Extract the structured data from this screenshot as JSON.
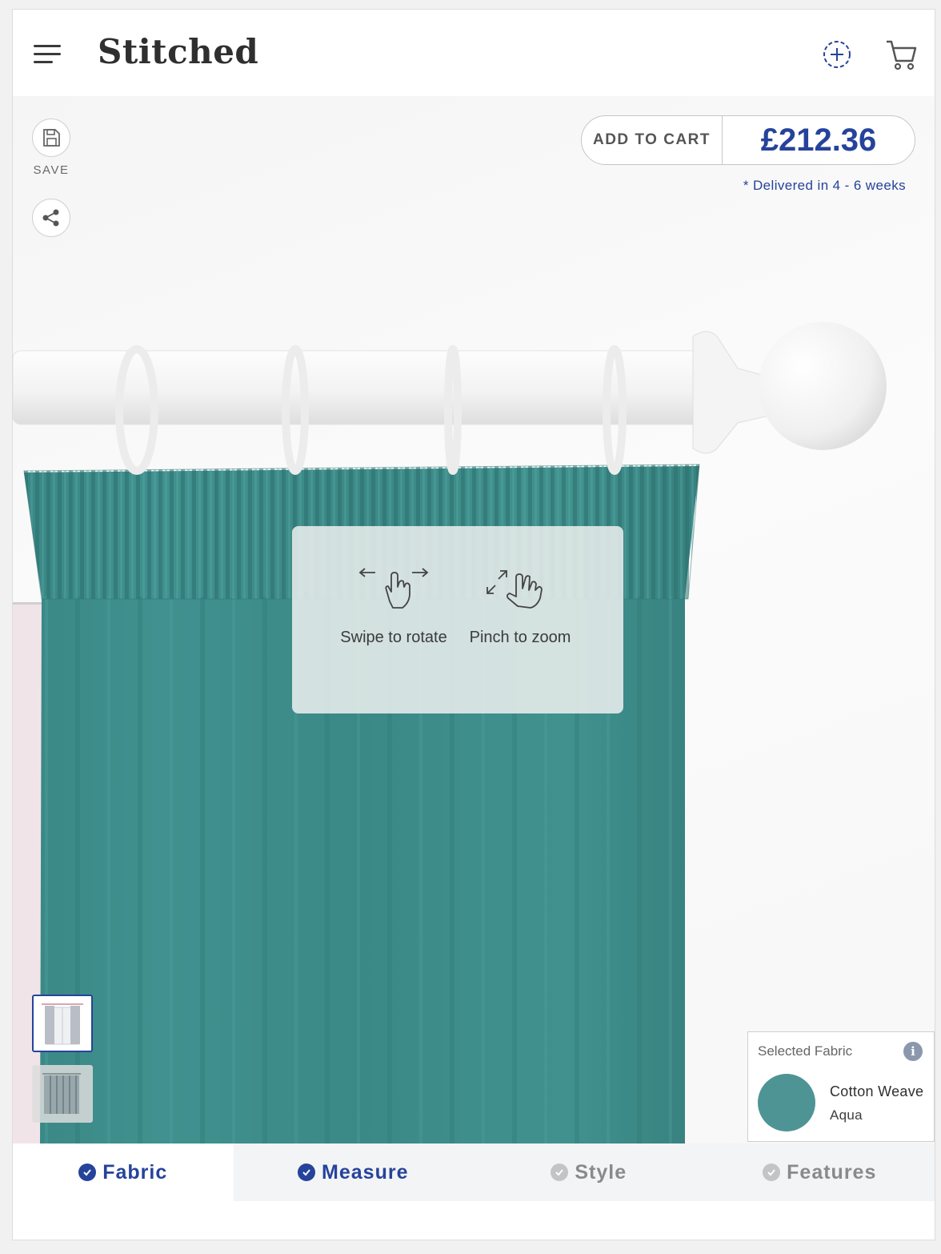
{
  "header": {
    "logo": "Stitched",
    "icons": [
      "menu-icon",
      "add-icon",
      "cart-icon"
    ]
  },
  "toolbar": {
    "save_label": "SAVE",
    "save_icon": "floppy-disk-icon",
    "share_icon": "share-icon"
  },
  "cart": {
    "add_label": "ADD TO CART",
    "price": "£212.36",
    "delivery": "* Delivered in 4 - 6 weeks"
  },
  "gestures": {
    "rotate_label": "Swipe to rotate",
    "zoom_label": "Pinch to zoom"
  },
  "thumbnails": [
    "curtain-full-view",
    "curtain-fabric-closeup"
  ],
  "selected_fabric": {
    "title": "Selected Fabric",
    "info": "i",
    "name": "Cotton Weave",
    "color": "Aqua",
    "swatch_color": "#4f9494"
  },
  "tabs": [
    {
      "label": "Fabric",
      "state": "complete",
      "active": true
    },
    {
      "label": "Measure",
      "state": "complete",
      "active": false
    },
    {
      "label": "Style",
      "state": "incomplete",
      "active": false
    },
    {
      "label": "Features",
      "state": "incomplete",
      "active": false
    }
  ],
  "colors": {
    "brand_blue": "#26439b",
    "curtain_teal": "#3b8a88"
  }
}
